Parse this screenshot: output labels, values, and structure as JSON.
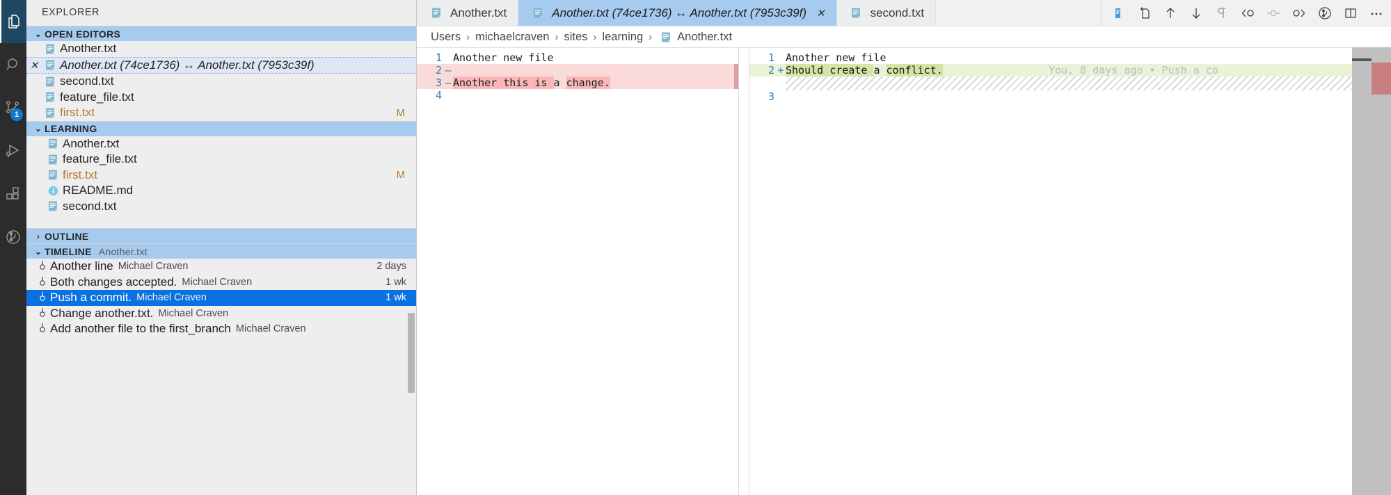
{
  "activitybar": {
    "items": [
      {
        "name": "explorer",
        "icon": "files-icon",
        "active": true,
        "badge": null
      },
      {
        "name": "search",
        "icon": "search-icon",
        "active": false,
        "badge": null
      },
      {
        "name": "source-control",
        "icon": "source-control-icon",
        "active": false,
        "badge": "1"
      },
      {
        "name": "run-and-debug",
        "icon": "run-debug-icon",
        "active": false,
        "badge": null
      },
      {
        "name": "extensions",
        "icon": "extensions-icon",
        "active": false,
        "badge": null
      },
      {
        "name": "timeline",
        "icon": "history-icon",
        "active": false,
        "badge": null
      }
    ]
  },
  "sidebar": {
    "title": "EXPLORER",
    "open_editors": {
      "header": "OPEN EDITORS",
      "twisty": "⌄",
      "items": [
        {
          "label": "Another.txt",
          "icon": "text-file-icon",
          "active": false,
          "modified": "",
          "closable": false
        },
        {
          "label": "Another.txt (74ce1736) ↔ Another.txt (7953c39f)",
          "icon": "text-file-icon",
          "active": true,
          "modified": "",
          "closable": true
        },
        {
          "label": "second.txt",
          "icon": "text-file-icon",
          "active": false,
          "modified": "",
          "closable": false
        },
        {
          "label": "feature_file.txt",
          "icon": "text-file-icon",
          "active": false,
          "modified": "",
          "closable": false
        },
        {
          "label": "first.txt",
          "icon": "text-file-icon",
          "active": false,
          "modified": "M",
          "closable": false
        }
      ]
    },
    "workspace": {
      "header": "LEARNING",
      "twisty": "⌄",
      "items": [
        {
          "label": "Another.txt",
          "icon": "text-file-icon",
          "modified": ""
        },
        {
          "label": "feature_file.txt",
          "icon": "text-file-icon",
          "modified": ""
        },
        {
          "label": "first.txt",
          "icon": "text-file-icon",
          "modified": "M"
        },
        {
          "label": "README.md",
          "icon": "markdown-info-icon",
          "modified": ""
        },
        {
          "label": "second.txt",
          "icon": "text-file-icon",
          "modified": ""
        }
      ]
    },
    "outline": {
      "header": "OUTLINE",
      "twisty": "›"
    },
    "timeline": {
      "header": "TIMELINE",
      "twisty": "⌄",
      "subtitle": "Another.txt",
      "items": [
        {
          "message": "Another line",
          "author": "Michael Craven",
          "time": "2 days",
          "selected": false
        },
        {
          "message": "Both changes accepted.",
          "author": "Michael Craven",
          "time": "1 wk",
          "selected": false
        },
        {
          "message": "Push a commit.",
          "author": "Michael Craven",
          "time": "1 wk",
          "selected": true
        },
        {
          "message": "Change another.txt.",
          "author": "Michael Craven",
          "time": "",
          "selected": false
        },
        {
          "message": "Add another file to the first_branch",
          "author": "Michael Craven",
          "time": "",
          "selected": false
        }
      ]
    }
  },
  "editor": {
    "tabs": [
      {
        "label": "Another.txt",
        "icon": "text-file-icon",
        "active": false,
        "close": ""
      },
      {
        "label": "Another.txt (74ce1736) ↔ Another.txt (7953c39f)",
        "icon": "text-file-icon",
        "active": true,
        "close": "✕"
      },
      {
        "label": "second.txt",
        "icon": "text-file-icon",
        "active": false,
        "close": ""
      }
    ],
    "actions": [
      {
        "name": "open-changes-icon",
        "glyph": "open-changes"
      },
      {
        "name": "open-file-icon",
        "glyph": "open-file"
      },
      {
        "name": "previous-change-icon",
        "glyph": "arrow-up"
      },
      {
        "name": "next-change-icon",
        "glyph": "arrow-down"
      },
      {
        "name": "ignore-whitespace-icon",
        "glyph": "pilcrow"
      },
      {
        "name": "go-to-previous-commit-icon",
        "glyph": "commit-left"
      },
      {
        "name": "commit-dot-icon",
        "glyph": "commit-dot"
      },
      {
        "name": "go-to-next-commit-icon",
        "glyph": "commit-right"
      },
      {
        "name": "toggle-blame-icon",
        "glyph": "clock"
      },
      {
        "name": "split-editor-icon",
        "glyph": "split"
      },
      {
        "name": "more-actions-icon",
        "glyph": "ellipsis"
      }
    ],
    "breadcrumb": {
      "separator": "›",
      "items": [
        "Users",
        "michaelcraven",
        "sites",
        "learning"
      ],
      "file": "Another.txt",
      "file_icon": "text-file-icon"
    },
    "diff": {
      "left": {
        "lines": [
          {
            "num": "1",
            "sign": "",
            "text": "Another new file",
            "state": "normal",
            "segments": [
              {
                "t": "Another new file",
                "hl": false
              }
            ]
          },
          {
            "num": "2",
            "sign": "—",
            "text": "",
            "state": "deleted",
            "segments": []
          },
          {
            "num": "3",
            "sign": "—",
            "text": "Another this is a change.",
            "state": "deleted",
            "segments": [
              {
                "t": "Another this is ",
                "hl": true
              },
              {
                "t": "a ",
                "hl": false
              },
              {
                "t": "change.",
                "hl": true
              }
            ]
          },
          {
            "num": "4",
            "sign": "",
            "text": "",
            "state": "normal",
            "segments": []
          }
        ]
      },
      "right": {
        "lines": [
          {
            "num": "1",
            "sign": "",
            "text": "Another new file",
            "state": "normal",
            "segments": [
              {
                "t": "Another new file",
                "hl": false
              }
            ],
            "blame": ""
          },
          {
            "num": "2",
            "sign": "+",
            "text": "Should create a conflict.",
            "state": "inserted",
            "segments": [
              {
                "t": "Should create ",
                "hl": true
              },
              {
                "t": "a ",
                "hl": false
              },
              {
                "t": "conflict.",
                "hl": true
              }
            ],
            "blame": "You, 8 days ago • Push a co"
          },
          {
            "num": "",
            "sign": "",
            "text": "",
            "state": "filler",
            "segments": [],
            "blame": ""
          },
          {
            "num": "3",
            "sign": "",
            "text": "",
            "state": "normal",
            "segments": [],
            "blame": ""
          }
        ]
      }
    }
  },
  "colors": {
    "accent": "#0a72e0",
    "section_header_bg": "#a6cbef",
    "sidebar_bg": "#eeeeee",
    "activitybar_bg": "#2c2c2c",
    "deleted_line": "#fbdada",
    "deleted_chunk": "#f9b7b7",
    "inserted_line": "#eaf2d8",
    "inserted_chunk": "#d4e6a5",
    "modified_badge": "#b2792b",
    "line_number": "#2b7bb9"
  }
}
